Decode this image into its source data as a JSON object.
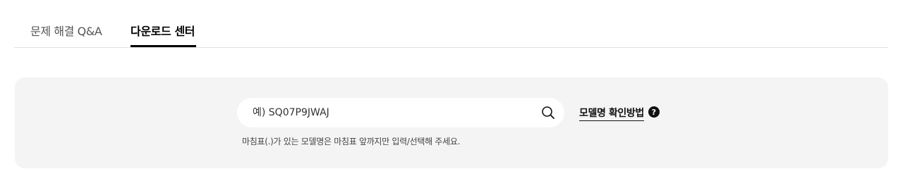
{
  "tabs": [
    {
      "label": "문제 해결 Q&A",
      "active": false
    },
    {
      "label": "다운로드 센터",
      "active": true
    }
  ],
  "search": {
    "placeholder": "예) SQ07P9JWAJ",
    "value": "",
    "icon": "search-icon"
  },
  "hint": "마침표(.)가 있는 모델명은 마침표 앞까지만 입력/선택해 주세요.",
  "howto": {
    "label": "모델명 확인방법",
    "icon_glyph": "?"
  },
  "colors": {
    "panel_bg": "#f4f4f4",
    "active_tab": "#000000",
    "inactive_tab": "#555555"
  }
}
